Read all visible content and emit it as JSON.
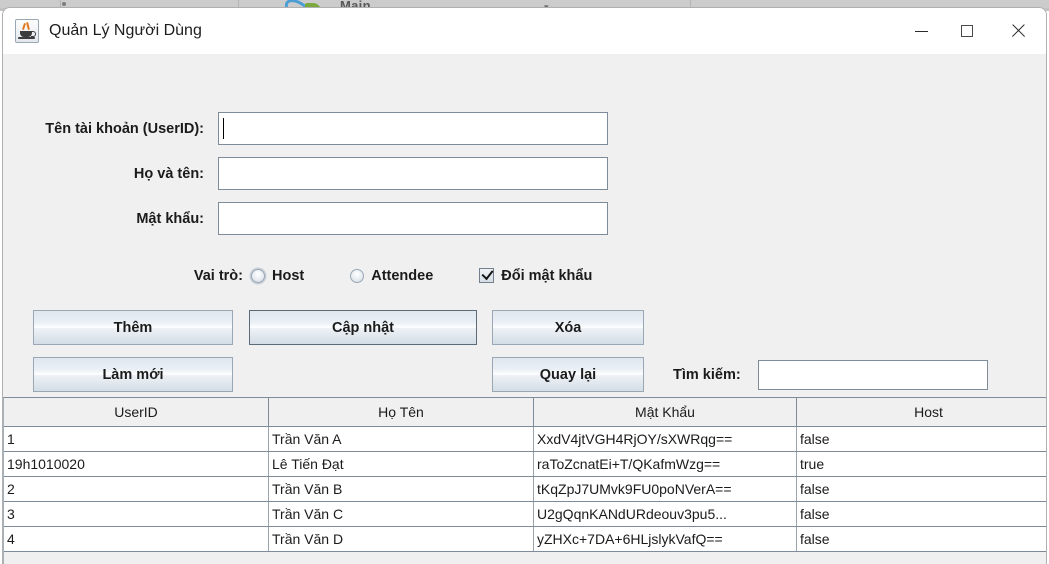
{
  "window": {
    "title": "Quản Lý Người Dùng",
    "icon": "java-icon",
    "controls": {
      "minimize": "minimize-icon",
      "maximize": "maximize-icon",
      "close": "close-icon"
    }
  },
  "desktop": {
    "ghost_text": "Main..."
  },
  "form": {
    "fields": [
      {
        "label": "Tên tài khoản (UserID):",
        "value": "",
        "focused": true
      },
      {
        "label": "Họ và tên:",
        "value": "",
        "focused": false
      },
      {
        "label": "Mật khẩu:",
        "value": "",
        "focused": false
      }
    ],
    "role": {
      "label": "Vai trò:",
      "options": [
        {
          "label": "Host",
          "selected": false
        },
        {
          "label": "Attendee",
          "selected": false
        }
      ],
      "change_password": {
        "label": "Đổi mật khẩu",
        "checked": true
      }
    }
  },
  "buttons": {
    "add": "Thêm",
    "update": "Cập nhật",
    "delete": "Xóa",
    "refresh": "Làm mới",
    "back": "Quay lại"
  },
  "search": {
    "label": "Tìm kiếm:",
    "value": "",
    "placeholder": ""
  },
  "table": {
    "columns": [
      "UserID",
      "Họ Tên",
      "Mật Khẩu",
      "Host"
    ],
    "rows": [
      [
        "1",
        "Trần Văn A",
        "XxdV4jtVGH4RjOY/sXWRqg==",
        "false"
      ],
      [
        "19h1010020",
        "Lê Tiến Đạt",
        "raToZcnatEi+T/QKafmWzg==",
        "true"
      ],
      [
        "2",
        "Trần Văn B",
        "tKqZpJ7UMvk9FU0poNVerA==",
        "false"
      ],
      [
        "3",
        "Trần Văn C",
        "U2gQqnKANdURdeouv3pu5...",
        "false"
      ],
      [
        "4",
        "Trần Văn D",
        "yZHXc+7DA+6HLjslykVafQ==",
        "false"
      ]
    ]
  },
  "colors": {
    "window_bg": "#f0f0f0",
    "titlebar_bg": "#ffffff",
    "field_border": "#7e8c99",
    "text": "#1b1b1b"
  }
}
